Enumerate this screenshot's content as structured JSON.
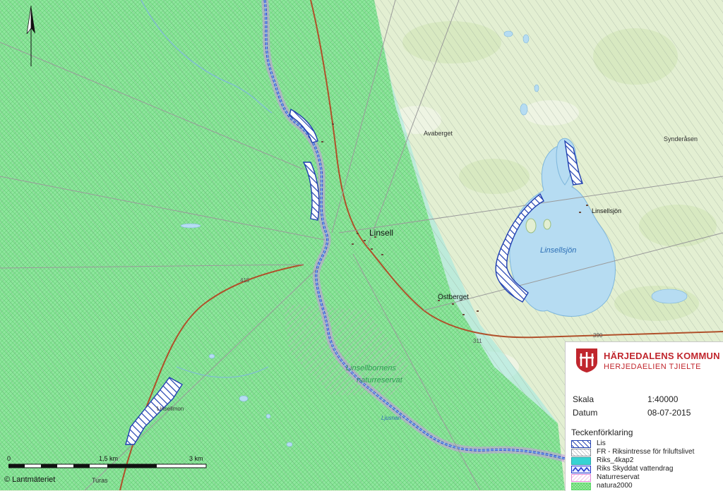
{
  "map": {
    "place_labels": [
      {
        "text": "Linsell",
        "key": "linsell"
      },
      {
        "text": "Linsellsjön",
        "key": "linsellsjon-town"
      },
      {
        "text": "Linsellsjön",
        "key": "linsellsjon-lake"
      },
      {
        "text": "Östberget",
        "key": "ostberget"
      },
      {
        "text": "Avaberget",
        "key": "avaberget"
      },
      {
        "text": "Synderåsen",
        "key": "synderasen"
      },
      {
        "text": "Linsellbornens",
        "key": "reserve-1"
      },
      {
        "text": "naturreservat",
        "key": "reserve-2"
      },
      {
        "text": "Turas",
        "key": "turas"
      },
      {
        "text": "Linsellmon",
        "key": "linsellmon"
      },
      {
        "text": "Ljusnan",
        "key": "ljusnan"
      }
    ],
    "road_numbers": [
      "415",
      "390",
      "311"
    ]
  },
  "legend": {
    "org_name": "HÄRJEDALENS KOMMUN",
    "org_subtitle": "HERJEDAELIEN TJIELTE",
    "scale_label": "Skala",
    "scale_value": "1:40000",
    "date_label": "Datum",
    "date_value": "08-07-2015",
    "title": "Teckenförklaring",
    "items": [
      {
        "label": "Lis",
        "symbol": "blue-hatch",
        "color": "#1f3fb0"
      },
      {
        "label": "FR - Riksintresse för friluftslivet",
        "symbol": "grey-hatch",
        "color": "#8a8f99"
      },
      {
        "label": "Riks_4kap2",
        "symbol": "cyan-fill",
        "color": "#36d3d3"
      },
      {
        "label": "Riks Skyddat vattendrag",
        "symbol": "blue-zigzag",
        "color": "#2233cc"
      },
      {
        "label": "Naturreservat",
        "symbol": "pink-hatch",
        "color": "#e58ad6"
      },
      {
        "label": "natura2000",
        "symbol": "green-hatch",
        "color": "#5fd86a"
      }
    ]
  },
  "scalebar": {
    "ticks": [
      "0",
      "1,5 km",
      "3 km"
    ]
  },
  "copyright": "© Lantmäteriet",
  "colors": {
    "lake": "#b6dcf2",
    "forest": "#e4efd3",
    "natura": "#7fe08e",
    "road": "#b0502a",
    "lis": "#1f3fb0",
    "brand": "#c0262d"
  },
  "icons": {
    "north": "north-arrow-icon",
    "brand": "harjedalen-coat-of-arms"
  }
}
